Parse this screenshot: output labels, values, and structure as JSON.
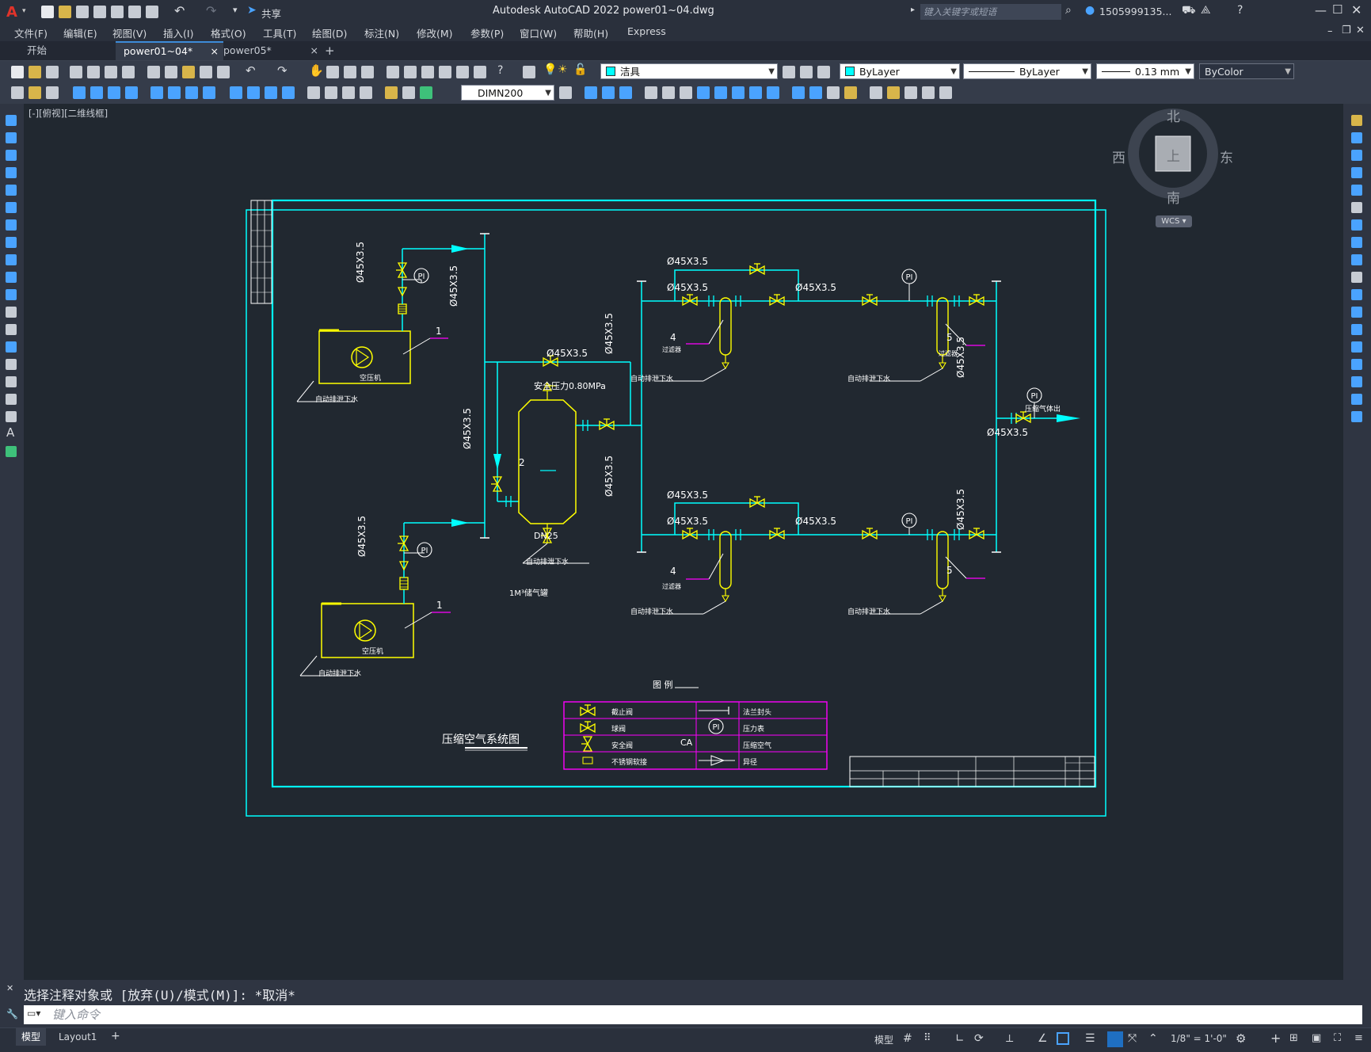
{
  "app": {
    "logo": "A",
    "share_label": "共享",
    "title": "Autodesk AutoCAD 2022    power01~04.dwg",
    "search_placeholder": "键入关键字或短语",
    "user": "1505999135..."
  },
  "menu": [
    "文件(F)",
    "编辑(E)",
    "视图(V)",
    "插入(I)",
    "格式(O)",
    "工具(T)",
    "绘图(D)",
    "标注(N)",
    "修改(M)",
    "参数(P)",
    "窗口(W)",
    "帮助(H)",
    "Express"
  ],
  "tabs": [
    {
      "label": "开始",
      "close": ""
    },
    {
      "label": "power01~04*",
      "close": "×"
    },
    {
      "label": "power05*",
      "close": "×"
    },
    {
      "label": "+",
      "close": ""
    }
  ],
  "toolbar": {
    "layer": "洁具",
    "color": "ByLayer",
    "linetype": "ByLayer",
    "lineweight": "0.13 mm",
    "plotstyle": "ByColor",
    "dimstyle": "DIMN200"
  },
  "viewport": {
    "label": "[-][俯视][二维线框]",
    "viewcube": {
      "north": "北",
      "south": "南",
      "east": "东",
      "west": "西",
      "top": "上",
      "wcs": "WCS"
    }
  },
  "drawing": {
    "pipe_spec": "Ø45X3.5",
    "pipe_spec_no_space": "ø45X3.5",
    "safety_pressure": "安全压力0.80MPa",
    "dn_label": "DN25",
    "tank_label": "1M³储气罐",
    "tank_number": "2",
    "compressor_number": "1",
    "compressor_name": "空压机",
    "drain_label": "自动排泄下水",
    "filter_number_a": "4",
    "filter_number_b": "5",
    "filter_name": "过滤器",
    "gauge": "PI",
    "outlet_label": "压缩气体出",
    "title": "压缩空气系统图",
    "legend_title": "图 例",
    "legend_rows": [
      {
        "name": "截止阀",
        "name2": "法兰封头"
      },
      {
        "name": "球阀",
        "name2": "压力表"
      },
      {
        "name": "安全阀",
        "name2": "压缩空气"
      },
      {
        "name": "不锈钢软接",
        "name2": "异径"
      }
    ],
    "legend_ca": "CA",
    "legend_pi": "PI"
  },
  "command": {
    "history": "选择注释对象或 [放弃(U)/模式(M)]: *取消*",
    "placeholder": "键入命令"
  },
  "status": {
    "layout_tabs": [
      "模型",
      "Layout1",
      "+"
    ],
    "model": "模型",
    "scale": "1/8\" = 1'-0\""
  }
}
